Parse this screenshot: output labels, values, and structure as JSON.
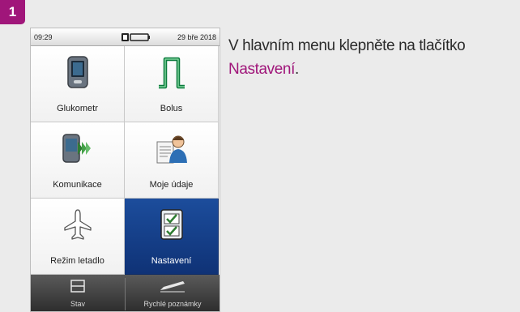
{
  "step": {
    "number": "1"
  },
  "device": {
    "status_bar": {
      "time": "09:29",
      "date": "29 bře 2018"
    },
    "tiles": [
      {
        "label": "Glukometr",
        "icon": "meter-icon"
      },
      {
        "label": "Bolus",
        "icon": "bolus-icon"
      },
      {
        "label": "Komunikace",
        "icon": "communication-icon"
      },
      {
        "label": "Moje údaje",
        "icon": "my-data-icon"
      },
      {
        "label": "Režim letadlo",
        "icon": "airplane-icon"
      },
      {
        "label": "Nastavení",
        "icon": "settings-checklist-icon",
        "selected": true
      }
    ],
    "bottom_bar": {
      "status_label": "Stav",
      "notes_label": "Rychlé poznámky"
    }
  },
  "instruction": {
    "text_before": "V hlavním menu klepněte na tlačítko",
    "highlight": "Nastavení",
    "text_after": "."
  },
  "colors": {
    "accent": "#a0167a",
    "selected_tile": "#1c4d9c"
  }
}
